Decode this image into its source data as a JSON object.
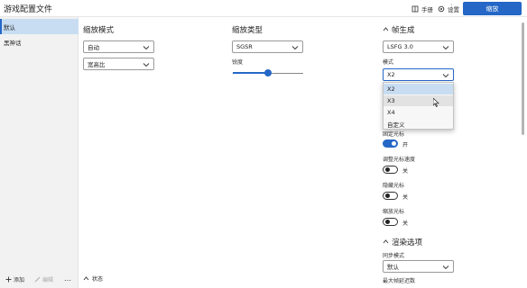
{
  "app": {
    "title": "游戏配置文件"
  },
  "header": {
    "manual_label": "手册",
    "settings_label": "设置",
    "scale_button_label": "缩放"
  },
  "sidebar": {
    "items": [
      {
        "label": "默认",
        "selected": true
      },
      {
        "label": "黑神话",
        "selected": false
      }
    ],
    "add_label": "添加",
    "edit_label": "编辑",
    "more_label": "…"
  },
  "scaling_mode": {
    "title": "缩放模式",
    "mode_value": "自动",
    "aspect_value": "宽高比"
  },
  "scaling_type": {
    "title": "缩放类型",
    "type_value": "SGSR",
    "sharpness_label": "锐度",
    "sharpness_value": 0.5
  },
  "frame_gen": {
    "title": "帧生成",
    "version_value": "LSFG 3.0",
    "mode_label": "模式",
    "mode_value": "X2",
    "mode_options": [
      "X2",
      "X3",
      "X4",
      "自定义"
    ],
    "cursor_capture_label": "固定光标",
    "cursor_capture_state": "开",
    "cursor_speed_label": "调整光标速度",
    "cursor_speed_state": "关",
    "hide_cursor_label": "隐藏光标",
    "hide_cursor_state": "关",
    "scale_cursor_label": "缩放光标",
    "scale_cursor_state": "关"
  },
  "render": {
    "title": "渲染选项",
    "sync_label": "同步模式",
    "sync_value": "默认",
    "max_delay_label": "最大帧延迟数"
  },
  "status": {
    "label": "状态"
  },
  "colors": {
    "accent": "#2467c7",
    "sidebar_bg": "#f2f2f2",
    "selected_bg": "#c8ddf2"
  }
}
